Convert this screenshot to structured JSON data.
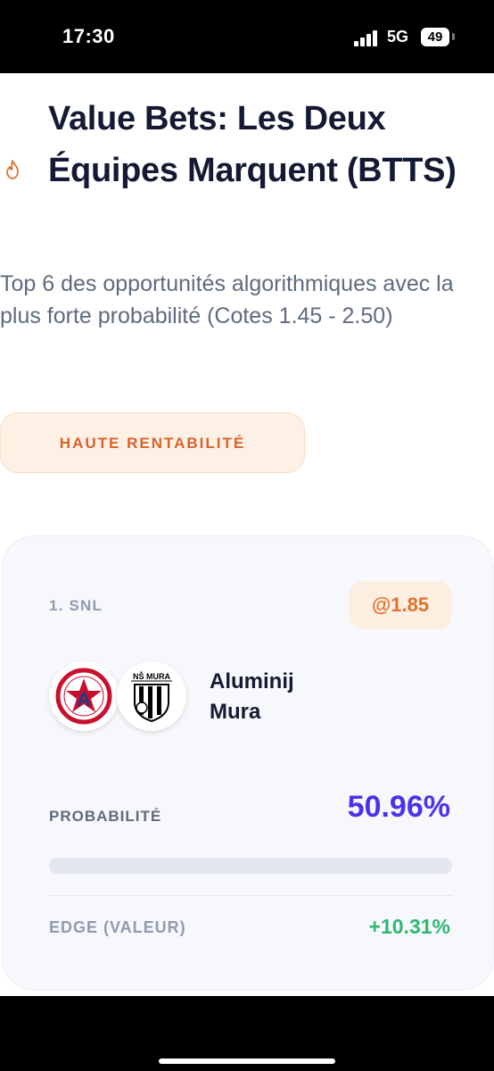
{
  "status_bar": {
    "time": "17:30",
    "network": "5G",
    "battery": "49"
  },
  "header": {
    "title": "Value Bets: Les Deux Équipes Marquent (BTTS)",
    "title_icon": "fire-icon",
    "subtitle": "Top 6 des opportunités algorithmiques avec la plus forte probabilité (Cotes 1.45 - 2.50)",
    "badge": "HAUTE RENTABILITÉ"
  },
  "match": {
    "league": "1. SNL",
    "odds": "@1.85",
    "home_team": "Aluminij",
    "away_team": "Mura",
    "home_logo": "aluminij-crest",
    "away_logo": "ns-mura-crest",
    "probability_label": "PROBABILITÉ",
    "probability_value": "50.96%",
    "probability_fraction": 0.5096,
    "edge_label": "EDGE (VALEUR)",
    "edge_value": "+10.31%"
  },
  "colors": {
    "accent_purple": "#4a33e8",
    "accent_orange": "#e0732d",
    "positive_green": "#2eb872",
    "title_text": "#141a33"
  }
}
